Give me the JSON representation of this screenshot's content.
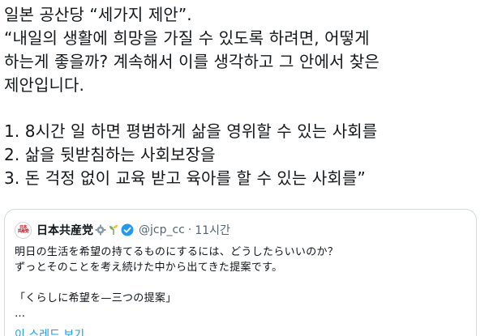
{
  "tweet": {
    "lines": [
      "일본 공산당 “세가지 제안”.",
      "“내일의 생활에 희망을 가질 수 있도록 하려면, 어떻게",
      "하는게 좋을까? 계속해서 이를 생각하고 그 안에서 찾은",
      "제안입니다.",
      "1. 8시간 일 하면 평범하게 삶을 영위할 수 있는 사회를",
      "2. 삶을 뒷받침하는 사회보장을",
      "3. 돈 걱정 없이 교육 받고 육아를 할 수 있는 사회를”"
    ]
  },
  "quote": {
    "avatar_text_top": "日本",
    "avatar_text_bottom": "共産党",
    "author_name": "日本共産党",
    "emoji_icons": [
      "gear-emoji",
      "sprout-emoji"
    ],
    "verified_icon": "verified-badge-icon",
    "handle": "@jcp_cc",
    "separator": "·",
    "time": "11시간",
    "lines": [
      "明日の生活を希望の持てるものにするには、どうしたらいいのか？",
      "ずっとそのことを考え続けた中から出てきた提案です。",
      "「くらしに希望を—三つの提案」",
      "…"
    ],
    "show_thread": "이 스레드 보기"
  },
  "colors": {
    "text": "#14171a",
    "secondary": "#536471",
    "link": "#1d9bf0",
    "border": "#cfd9de",
    "verified": "#1d9bf0",
    "logo_red": "#d7000f"
  }
}
